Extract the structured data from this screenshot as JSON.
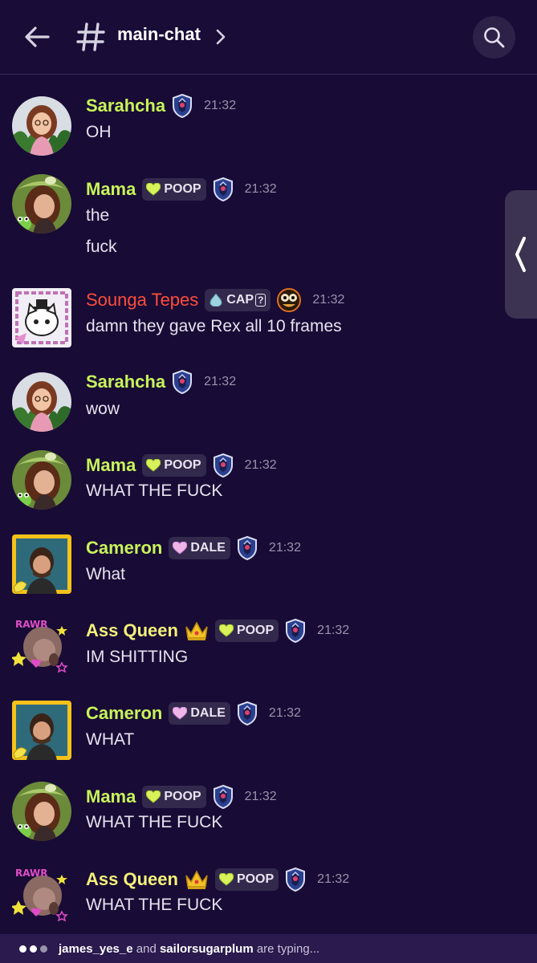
{
  "header": {
    "channel_name": "main-chat"
  },
  "colors": {
    "background": "#180b35",
    "name_green": "#c8f35a",
    "name_red": "#ff4d3c",
    "name_yellow": "#f3f07a",
    "timestamp": "#9a93ac"
  },
  "messages": [
    {
      "author": "Sarahcha",
      "name_color": "#c8f35a",
      "time": "21:32",
      "lines": [
        "OH"
      ]
    },
    {
      "author": "Mama",
      "name_color": "#c8f35a",
      "tag": "POOP",
      "time": "21:32",
      "lines": [
        "the",
        "fuck"
      ]
    },
    {
      "author": "Sounga Tepes",
      "name_color": "#ff4d3c",
      "tag": "CAP",
      "tag_suffix": "?",
      "time": "21:32",
      "lines": [
        "damn they gave Rex all 10 frames"
      ]
    },
    {
      "author": "Sarahcha",
      "name_color": "#c8f35a",
      "time": "21:32",
      "lines": [
        "wow"
      ]
    },
    {
      "author": "Mama",
      "name_color": "#c8f35a",
      "tag": "POOP",
      "time": "21:32",
      "lines": [
        "WHAT THE FUCK"
      ]
    },
    {
      "author": "Cameron",
      "name_color": "#c8f35a",
      "tag": "DALE",
      "time": "21:32",
      "lines": [
        "What"
      ]
    },
    {
      "author": "Ass Queen",
      "name_color": "#f3f07a",
      "tag": "POOP",
      "time": "21:32",
      "lines": [
        "IM SHITTING"
      ]
    },
    {
      "author": "Cameron",
      "name_color": "#c8f35a",
      "tag": "DALE",
      "time": "21:32",
      "lines": [
        "WHAT"
      ]
    },
    {
      "author": "Mama",
      "name_color": "#c8f35a",
      "tag": "POOP",
      "time": "21:32",
      "lines": [
        "WHAT THE FUCK"
      ]
    },
    {
      "author": "Ass Queen",
      "name_color": "#f3f07a",
      "tag": "POOP",
      "time": "21:32",
      "lines": [
        "WHAT THE FUCK"
      ]
    }
  ],
  "typing": {
    "user1": "james_yes_e",
    "connector": " and ",
    "user2": "sailorsugarplum",
    "suffix": " are typing..."
  }
}
